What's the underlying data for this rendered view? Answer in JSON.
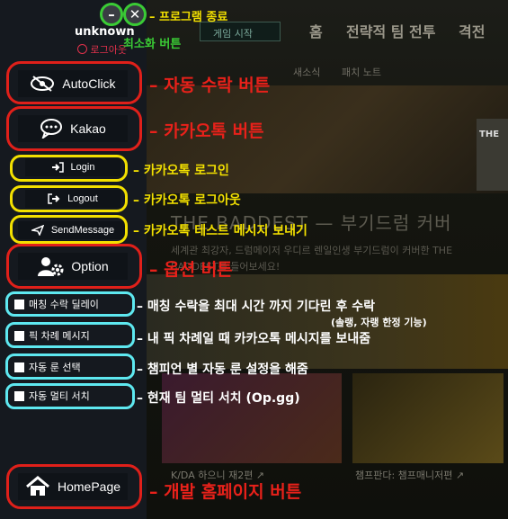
{
  "background": {
    "play_button": "게임 시작",
    "nav": [
      "홈",
      "전략적 팀 전투",
      "격전"
    ],
    "sub_tabs": [
      "새소식",
      "패치 노트"
    ],
    "title": "THE BADDEST — 부기드럼 커버",
    "desc": "세계관 최강자, 드럼메이저 우디르 렌일인생 부기드럼이 커버한 THE BADDEST를 들어보세요!",
    "captions": [
      "K/DA 하으니 재2편 ↗",
      "챔프판다: 챔프매니저편 ↗"
    ],
    "side_mark": "THE"
  },
  "window": {
    "username": "unknown",
    "login_link": "로그아웃",
    "minimize_symbol": "–",
    "close_symbol": "✕"
  },
  "sidebar": {
    "autoclick": "AutoClick",
    "kakao": "Kakao",
    "login": "Login",
    "logout": "Logout",
    "sendmessage": "SendMessage",
    "option": "Option",
    "checks": [
      "매칭 수락 딜레이",
      "픽 차례 메시지",
      "자동 룬 선택",
      "자동 멀티 서치"
    ],
    "homepage": "HomePage"
  },
  "annotations": {
    "exit": "프로그램 종료",
    "minimize": "최소화 버튼",
    "autoclick": "자동 수락 버튼",
    "kakao": "카카오톡 버튼",
    "login": "카카오톡 로그인",
    "logout": "카카오톡 로그아웃",
    "send": "카카오톡 테스트 메시지 보내기",
    "option": "옵션 버튼",
    "delay": "매칭 수락을 최대 시간 까지 기다린 후 수락",
    "delay_sub": "(솔랭, 자랭 한정 기능)",
    "pick": "내 픽 차례일 때 카카오톡 메시지를 보내줌",
    "rune": "챔피언 별 자동 룬 설정을 해줌",
    "multi": "현재 팀 멀티 서치 (Op.gg)",
    "homepage": "개발 홈페이지 버튼"
  },
  "colors": {
    "red": "#e8211a",
    "yellow": "#f3e000",
    "cyan": "#5ee8f0",
    "green": "#3acb35"
  }
}
